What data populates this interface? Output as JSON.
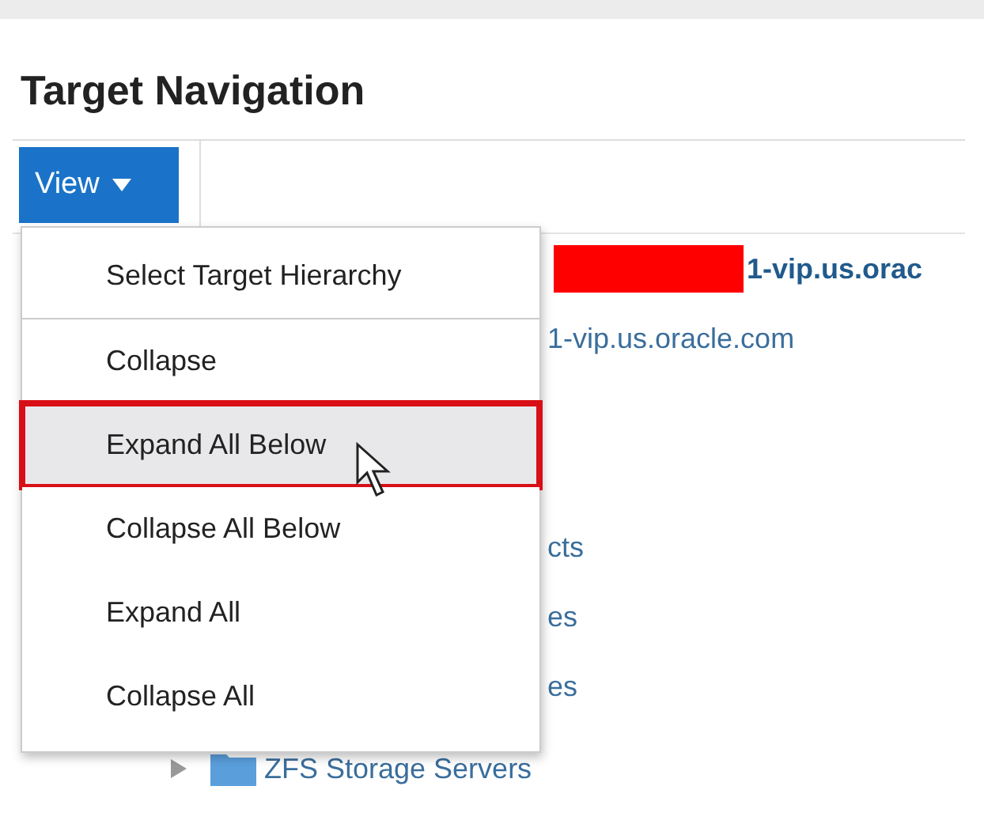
{
  "title": "Target Navigation",
  "view_button": {
    "label": "View",
    "expanded": true
  },
  "menu": [
    {
      "label": "Select Target Hierarchy",
      "selected": false,
      "outlined": false,
      "divider_after": true
    },
    {
      "label": "Collapse",
      "selected": false,
      "outlined": false,
      "divider_after": false
    },
    {
      "label": "Expand All Below",
      "selected": true,
      "outlined": true,
      "divider_after": false
    },
    {
      "label": "Collapse All Below",
      "selected": false,
      "outlined": false,
      "divider_after": false
    },
    {
      "label": "Expand All",
      "selected": false,
      "outlined": false,
      "divider_after": false
    },
    {
      "label": "Collapse All",
      "selected": false,
      "outlined": false,
      "divider_after": false
    }
  ],
  "tree": [
    {
      "kind": "redacted",
      "text": "1-vip.us.orac"
    },
    {
      "kind": "host",
      "text": "1-vip.us.oracle.com"
    },
    {
      "kind": "fragment",
      "text": "cts"
    },
    {
      "kind": "fragment",
      "text": "es"
    },
    {
      "kind": "fragment",
      "text": "es"
    },
    {
      "kind": "folder",
      "text": "ZFS Storage Servers",
      "expanded": false
    }
  ]
}
